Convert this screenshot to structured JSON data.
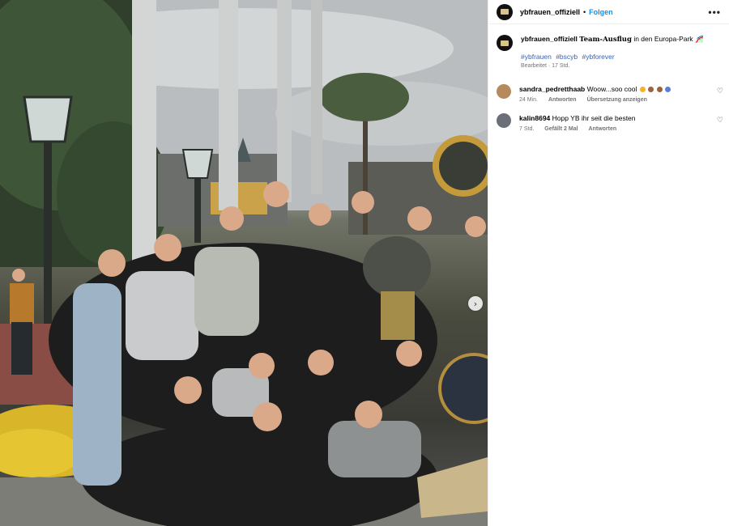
{
  "post": {
    "image_alt": "Team group photo at Europa-Park",
    "carousel_next": "›"
  },
  "header": {
    "username": "ybfrauen_offiziell",
    "separator": "•",
    "follow_label": "Folgen",
    "more_label": "•••"
  },
  "caption": {
    "username": "ybfrauen_offiziell",
    "highlight": "Team-Ausflug",
    "text": "in den Europa-Park",
    "emoji": "🎢",
    "hashtags": [
      "#ybfrauen",
      "#bscyb",
      "#ybforever"
    ],
    "edited": "Bearbeitet · 17 Std."
  },
  "comments": [
    {
      "username": "sandra_pedretthaab",
      "text": "Woow...soo cool",
      "time": "24 Min.",
      "reply_label": "Antworten",
      "translate_label": "Übersetzung anzeigen",
      "avatar_color": "#b58b5e"
    },
    {
      "username": "kalin8694",
      "text": "Hopp YB ihr seit die besten",
      "time": "7 Std.",
      "likes_label": "Gefällt 2 Mal",
      "reply_label": "Antworten",
      "avatar_color": "#6b6f78"
    }
  ],
  "icons": {
    "heart": "♡"
  },
  "colors": {
    "follow": "#0095f6",
    "hashtag": "#3a62b4",
    "meta": "#737373"
  }
}
